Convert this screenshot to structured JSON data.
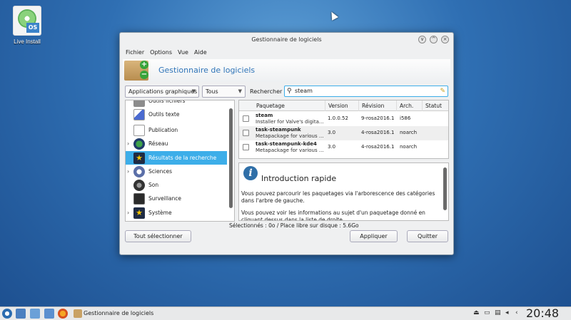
{
  "desktop": {
    "icon_label": "Live Install",
    "icon_badge": "OS"
  },
  "window": {
    "title": "Gestionnaire de logiciels",
    "controls": [
      "∨",
      "^",
      "×"
    ],
    "menu": [
      "Fichier",
      "Options",
      "Vue",
      "Aide"
    ],
    "banner_title": "Gestionnaire de logiciels",
    "filter_apps": "Applications graphiques",
    "filter_state": "Tous",
    "search_label": "Rechercher :",
    "search_value": "steam",
    "categories": [
      {
        "label": "Outils fichiers",
        "expandable": false,
        "selected": false
      },
      {
        "label": "Outils texte",
        "expandable": false,
        "selected": false
      },
      {
        "label": "Publication",
        "expandable": false,
        "selected": false
      },
      {
        "label": "Réseau",
        "expandable": true,
        "selected": false
      },
      {
        "label": "Résultats de la recherche",
        "expandable": false,
        "selected": true
      },
      {
        "label": "Sciences",
        "expandable": true,
        "selected": false
      },
      {
        "label": "Son",
        "expandable": false,
        "selected": false
      },
      {
        "label": "Surveillance",
        "expandable": false,
        "selected": false
      },
      {
        "label": "Système",
        "expandable": true,
        "selected": false
      }
    ],
    "columns": [
      "Paquetage",
      "Version",
      "Révision",
      "Arch.",
      "Statut"
    ],
    "packages": [
      {
        "name": "steam",
        "desc": "Installer for Valve's digita...",
        "version": "1.0.0.52",
        "revision": "9-rosa2016.1",
        "arch": "i586",
        "status": ""
      },
      {
        "name": "task-steampunk",
        "desc": "Metapackage for various ...",
        "version": "3.0",
        "revision": "4-rosa2016.1",
        "arch": "noarch",
        "status": ""
      },
      {
        "name": "task-steampunk-kde4",
        "desc": "Metapackage for various ...",
        "version": "3.0",
        "revision": "4-rosa2016.1",
        "arch": "noarch",
        "status": ""
      }
    ],
    "info_title": "Introduction rapide",
    "info_p1": "Vous pouvez parcourir les paquetages via l'arborescence des catégories dans l'arbre de gauche.",
    "info_p2": "Vous pouvez voir les informations au sujet d'un paquetage donné en cliquant dessus dans la liste de droite.",
    "status": "Sélectionnés : 0o / Place libre sur disque : 5.6Go",
    "select_all": "Tout sélectionner",
    "apply": "Appliquer",
    "quit": "Quitter"
  },
  "taskbar": {
    "task_label": "Gestionnaire de logiciels",
    "clock": "20:48"
  }
}
